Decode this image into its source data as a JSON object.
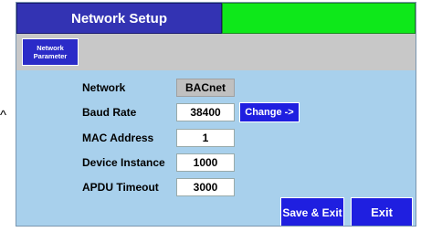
{
  "title": "Network Setup",
  "tabs": [
    {
      "line1": "Network",
      "line2": "Parameter"
    }
  ],
  "rows": {
    "network": {
      "label": "Network",
      "value": "BACnet"
    },
    "baud_rate": {
      "label": "Baud Rate",
      "value": "38400"
    },
    "mac_address": {
      "label": "MAC Address",
      "value": "1"
    },
    "device_instance": {
      "label": "Device Instance",
      "value": "1000"
    },
    "apdu_timeout": {
      "label": "APDU Timeout",
      "value": "3000"
    }
  },
  "buttons": {
    "change": "Change ->",
    "save_exit": "Save & Exit",
    "exit": "Exit"
  },
  "outside_caret": "^",
  "colors": {
    "title_bg": "#3333b3",
    "status_green": "#0ee81a",
    "panel_bg": "#a8d0ec",
    "tab_strip": "#c8c8c8",
    "button_blue": "#1f1fe0"
  }
}
